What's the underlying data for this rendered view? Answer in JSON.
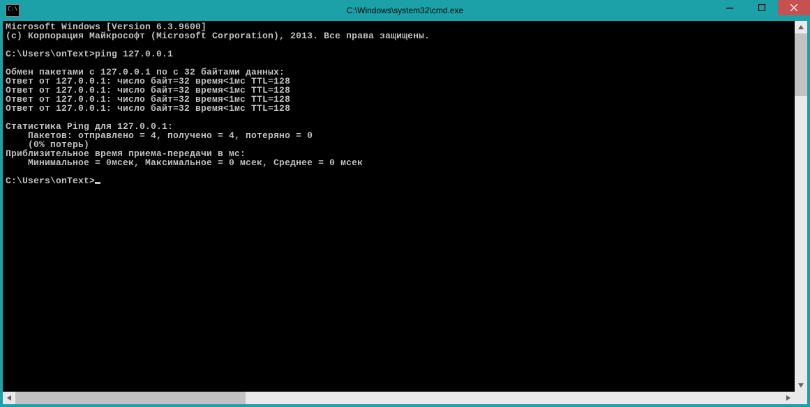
{
  "window": {
    "title": "C:\\Windows\\system32\\cmd.exe"
  },
  "terminal": {
    "header1": "Microsoft Windows [Version 6.3.9600]",
    "header2": "(c) Корпорация Майкрософт (Microsoft Corporation), 2013. Все права защищены.",
    "prompt1_path": "C:\\Users\\onText>",
    "prompt1_cmd": "ping 127.0.0.1",
    "line_exchange": "Обмен пакетами с 127.0.0.1 по с 32 байтами данных:",
    "reply1": "Ответ от 127.0.0.1: число байт=32 время<1мс TTL=128",
    "reply2": "Ответ от 127.0.0.1: число байт=32 время<1мс TTL=128",
    "reply3": "Ответ от 127.0.0.1: число байт=32 время<1мс TTL=128",
    "reply4": "Ответ от 127.0.0.1: число байт=32 время<1мс TTL=128",
    "stats_header": "Статистика Ping для 127.0.0.1:",
    "stats_packets": "    Пакетов: отправлено = 4, получено = 4, потеряно = 0",
    "stats_loss": "    (0% потерь)",
    "rtt_header": "Приблизительное время приема-передачи в мс:",
    "rtt_values": "    Минимальное = 0мсек, Максимальное = 0 мсек, Среднее = 0 мсек",
    "prompt2_path": "C:\\Users\\onText>"
  }
}
